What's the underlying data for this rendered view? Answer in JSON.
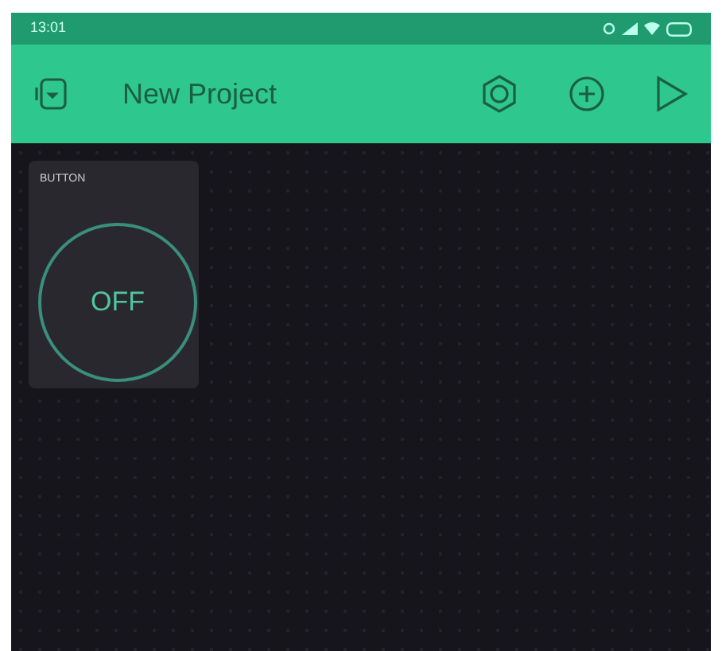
{
  "status_bar": {
    "time": "13:01"
  },
  "toolbar": {
    "title": "New Project"
  },
  "widgets": [
    {
      "kind": "button",
      "label": "BUTTON",
      "state_text": "OFF",
      "on": false
    }
  ]
}
